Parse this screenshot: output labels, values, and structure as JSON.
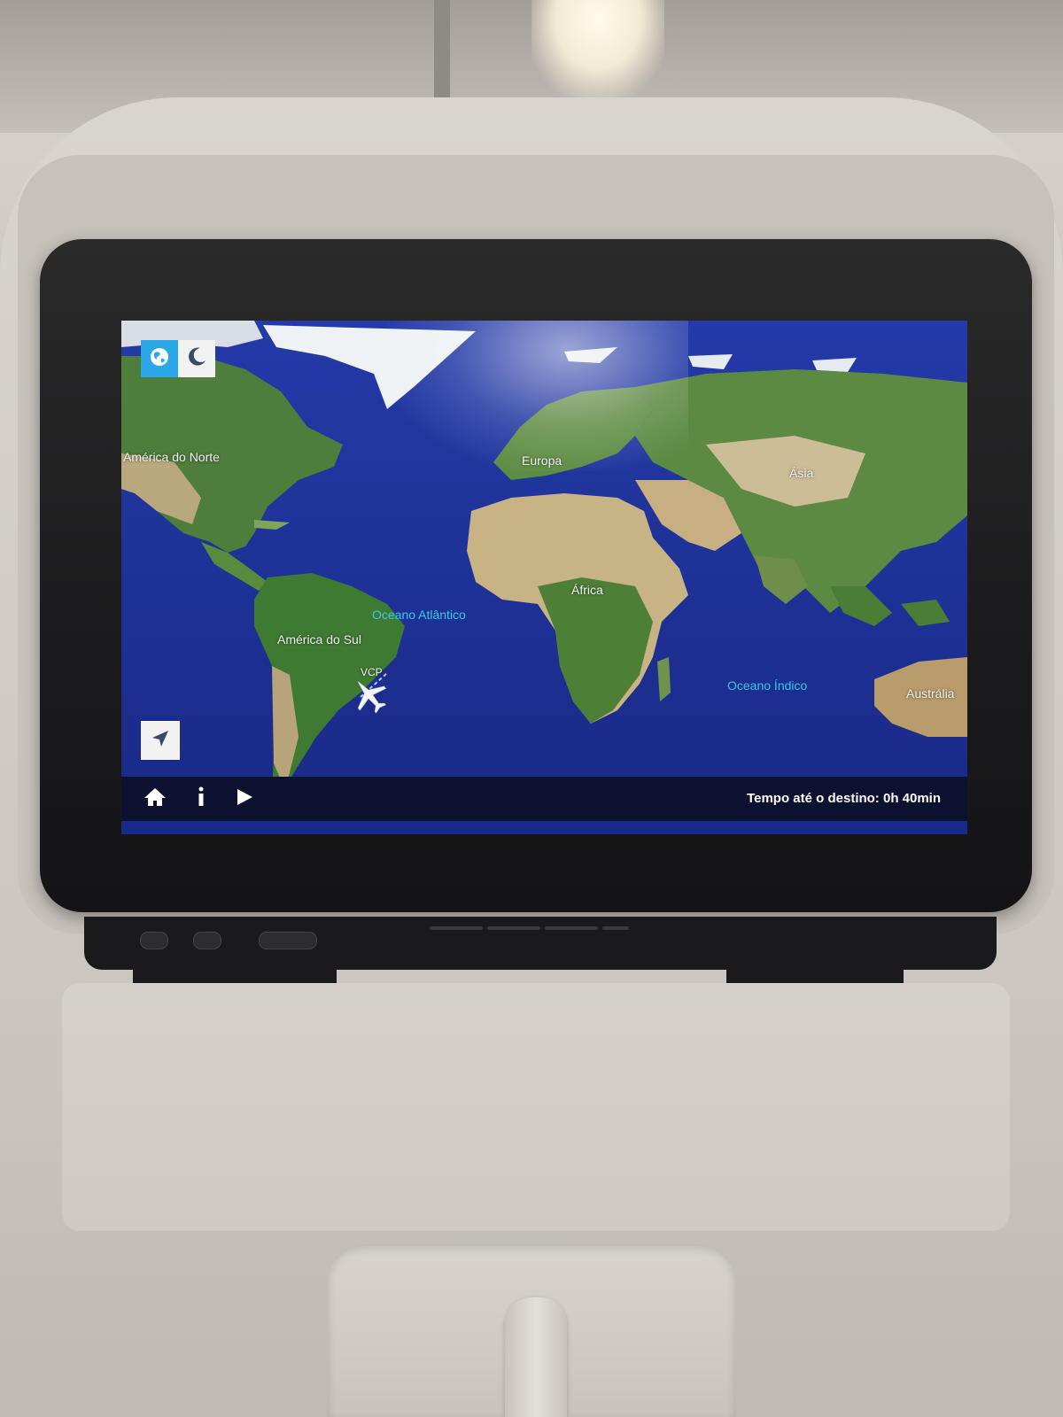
{
  "map": {
    "continent_labels": {
      "north_america": "América do Norte",
      "south_america": "América do Sul",
      "europe": "Europa",
      "africa": "África",
      "asia": "Ásia",
      "australia": "Austrália"
    },
    "ocean_labels": {
      "atlantic": "Oceano Atlântico",
      "indian": "Oceano Índico"
    },
    "flight": {
      "airport_code": "VCP"
    }
  },
  "toolbar": {
    "eta_text": "Tempo até o destino: 0h 40min"
  },
  "icons": {
    "mode_globe": "globe-icon",
    "mode_clock": "clock-moon-icon",
    "locate": "navigation-arrow-icon",
    "home": "home-icon",
    "info": "info-icon",
    "play": "play-icon",
    "plane": "airplane-icon"
  },
  "colors": {
    "ocean": "#1e2f97",
    "land_green": "#4a7a3a",
    "land_desert": "#c9b48a",
    "ice": "#f4f6f8",
    "ocean_label": "#39c8e8",
    "mode_active": "#2aa7e6",
    "bottom_bar": "#0d1130"
  }
}
